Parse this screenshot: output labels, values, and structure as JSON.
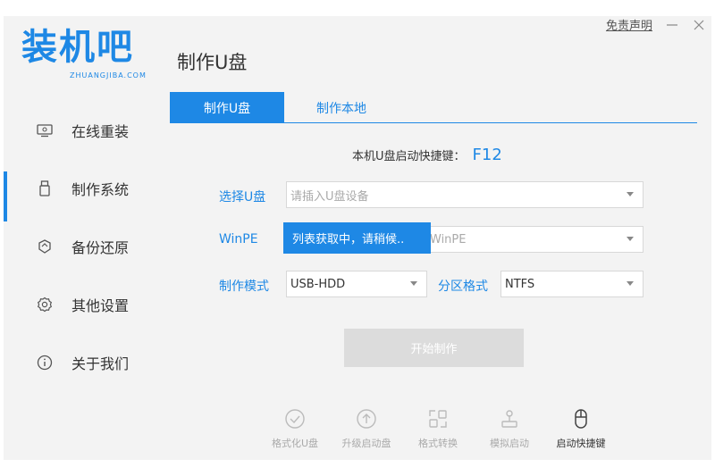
{
  "logo": {
    "text": "装机吧",
    "subtext": "ZHUANGJIBA.COM"
  },
  "header": {
    "title": "制作U盘",
    "disclaimer": "免责声明"
  },
  "sidebar": {
    "items": [
      {
        "label": "在线重装",
        "icon": "monitor-icon"
      },
      {
        "label": "制作系统",
        "icon": "usb-icon",
        "active": true
      },
      {
        "label": "备份还原",
        "icon": "restore-icon"
      },
      {
        "label": "其他设置",
        "icon": "gear-icon"
      },
      {
        "label": "关于我们",
        "icon": "info-icon"
      }
    ]
  },
  "tabs": [
    {
      "label": "制作U盘",
      "active": true
    },
    {
      "label": "制作本地",
      "active": false
    }
  ],
  "form": {
    "hotkey_label": "本机U盘启动快捷键：",
    "hotkey_value": "F12",
    "usb_label": "选择U盘",
    "usb_placeholder": "请插入U盘设备",
    "winpe_label": "WinPE",
    "winpe_value": "WinPE",
    "mode_label": "制作模式",
    "mode_value": "USB-HDD",
    "partition_label": "分区格式",
    "partition_value": "NTFS",
    "loading_toast": "列表获取中，请稍候..",
    "start_button": "开始制作"
  },
  "tools": [
    {
      "label": "格式化U盘",
      "icon": "check-circle-icon",
      "enabled": false
    },
    {
      "label": "升级启动盘",
      "icon": "arrow-up-circle-icon",
      "enabled": false
    },
    {
      "label": "格式转换",
      "icon": "convert-icon",
      "enabled": false
    },
    {
      "label": "模拟启动",
      "icon": "joystick-icon",
      "enabled": false
    },
    {
      "label": "启动快捷键",
      "icon": "mouse-icon",
      "enabled": true
    }
  ],
  "colors": {
    "accent": "#1e88e5",
    "disabled": "#dcdcdc",
    "background": "#f3f3f3"
  }
}
